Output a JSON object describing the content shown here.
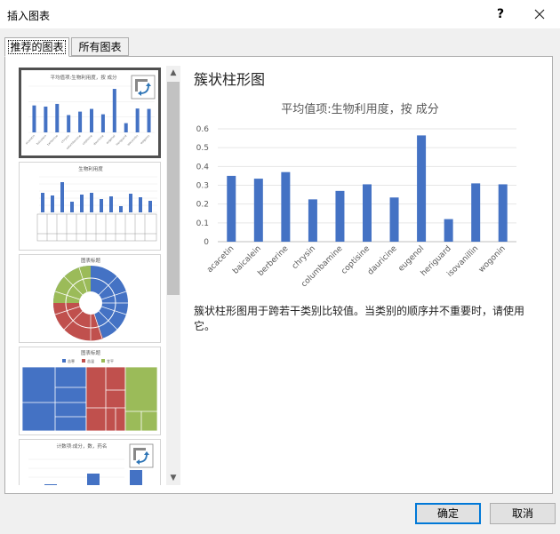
{
  "window": {
    "title": "插入图表",
    "help_label": "?"
  },
  "tabs": [
    {
      "label": "推荐的图表"
    },
    {
      "label": "所有图表"
    }
  ],
  "thumbnails": [
    {
      "title": "平均值项:生物利用度，按 成分"
    },
    {
      "title": "生物利用度"
    },
    {
      "title": "图表标题"
    },
    {
      "title": "图表标题",
      "legend": [
        "苦寒",
        "苦温",
        "甘平"
      ]
    },
    {
      "title": "计数项:成分，数，药名"
    }
  ],
  "preview": {
    "heading": "簇状柱形图",
    "description": "簇状柱形图用于跨若干类别比较值。当类别的顺序并不重要时，请使用它。"
  },
  "chart_data": {
    "type": "bar",
    "title": "平均值项:生物利用度，按  成分",
    "categories": [
      "acacetin",
      "baicalein",
      "berberine",
      "chrysin",
      "columbamine",
      "coptisine",
      "dauricine",
      "eugenol",
      "heriguard",
      "isovanillin",
      "wogonin"
    ],
    "values": [
      0.35,
      0.335,
      0.37,
      0.225,
      0.27,
      0.305,
      0.235,
      0.565,
      0.12,
      0.31,
      0.305
    ],
    "ylim": [
      0,
      0.6
    ],
    "yticks": [
      "0",
      "0.1",
      "0.2",
      "0.3",
      "0.4",
      "0.5",
      "0.6"
    ],
    "color": "#4472c4",
    "grid": true
  },
  "buttons": {
    "ok": "确定",
    "cancel": "取消"
  },
  "colors": {
    "bar": "#4472c4",
    "red": "#c0504d",
    "green": "#9bbb59"
  }
}
